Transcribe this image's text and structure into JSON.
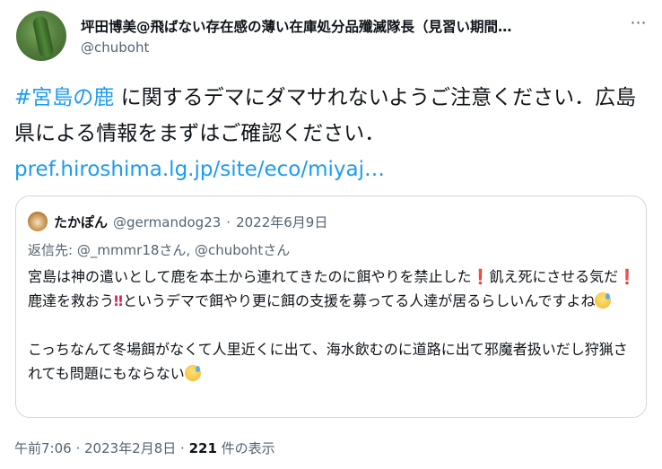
{
  "author": {
    "display_name": "坪田博美@飛ばない存在感の薄い在庫処分品殲滅隊長（見習い期間…",
    "handle": "@chuboht"
  },
  "more_icon": "⋯",
  "tweet": {
    "hashtag": "#宮島の鹿",
    "text_part1": " に関するデマにダマサれないようご注意ください．広島県による情報をまずはご確認ください．",
    "link": "pref.hiroshima.lg.jp/site/eco/miyaj…"
  },
  "quote": {
    "name": "たかぽん",
    "handle": "@germandog23",
    "separator": "·",
    "date": "2022年6月9日",
    "reply_prefix": "返信先: ",
    "reply_users": "@_mmmr18さん, @chubohtさん",
    "line1_a": "宮島は神の遣いとして鹿を本土から連れてきたのに餌やりを禁止した",
    "excl1": "❗",
    "line1_b": "飢え死にさせる気だ",
    "excl2": "❗",
    "line1_c": "鹿達を救おう",
    "excl3": "‼",
    "line1_d": "というデマで餌やり更に餌の支援を募ってる人達が居るらしいんですよね",
    "para2": "こっちなんて冬場餌がなくて人里近くに出て、海水飲むのに道路に出て邪魔者扱いだし狩猟されても問題にもならない"
  },
  "footer": {
    "time": "午前7:06",
    "sep1": " · ",
    "date": "2023年2月8日",
    "sep2": " · ",
    "views_count": "221",
    "views_label": " 件の表示"
  },
  "colors": {
    "link": "#1d9bf0",
    "secondary_text": "#536471",
    "border": "#cfd9de",
    "text": "#0f1419"
  }
}
